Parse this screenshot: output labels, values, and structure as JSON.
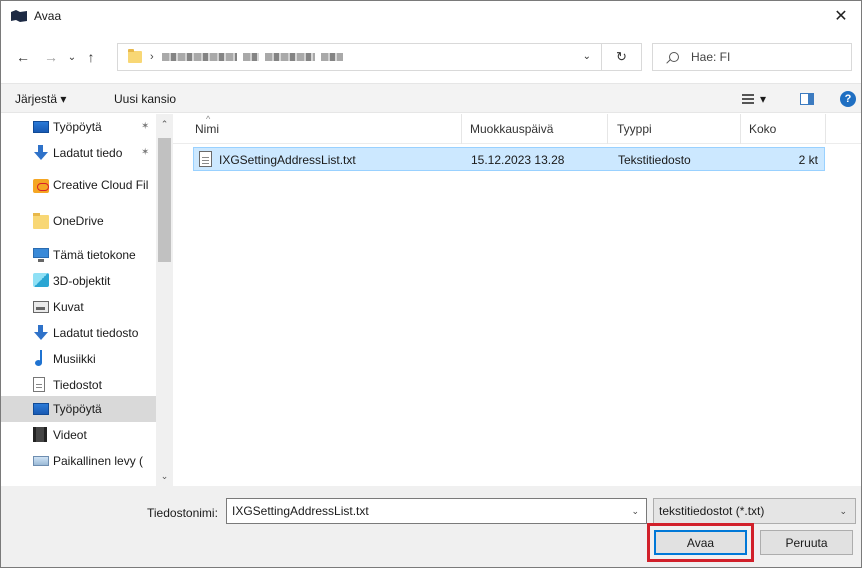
{
  "window": {
    "title": "Avaa",
    "close_glyph": "✕"
  },
  "address": {
    "back_glyph": "←",
    "forward_glyph": "→",
    "recent_glyph": "⌄",
    "up_glyph": "↑",
    "separator_glyph": "›",
    "dropdown_glyph": "⌄",
    "refresh_glyph": "↻",
    "search_placeholder": "Hae: FI"
  },
  "toolbar": {
    "organize_label": "Järjestä ▾",
    "new_folder_label": "Uusi kansio",
    "view_dropdown_glyph": "▾",
    "help_glyph": "?"
  },
  "sidebar": {
    "pin_glyph": "✶",
    "items": [
      {
        "label": "Työpöytä",
        "icon": "desktop-icon",
        "pinned": true
      },
      {
        "label": "Ladatut tiedo",
        "icon": "download-icon",
        "pinned": true
      },
      {
        "label": "Creative Cloud Fil",
        "icon": "creative-cloud-icon"
      },
      {
        "label": "OneDrive",
        "icon": "folder-icon"
      },
      {
        "label": "Tämä tietokone",
        "icon": "computer-icon"
      },
      {
        "label": "3D-objektit",
        "icon": "3d-objects-icon"
      },
      {
        "label": "Kuvat",
        "icon": "pictures-icon"
      },
      {
        "label": "Ladatut tiedosto",
        "icon": "download-icon"
      },
      {
        "label": "Musiikki",
        "icon": "music-icon"
      },
      {
        "label": "Tiedostot",
        "icon": "documents-icon"
      },
      {
        "label": "Työpöytä",
        "icon": "desktop-icon",
        "selected": true
      },
      {
        "label": "Videot",
        "icon": "videos-icon"
      },
      {
        "label": "Paikallinen levy (",
        "icon": "drive-icon"
      }
    ],
    "scroll_up_glyph": "⌃",
    "scroll_down_glyph": "⌄"
  },
  "file_list": {
    "columns": [
      "Nimi",
      "Muokkauspäivä",
      "Tyyppi",
      "Koko"
    ],
    "sort_glyph": "^",
    "rows": [
      {
        "name": "IXGSettingAddressList.txt",
        "modified": "15.12.2023 13.28",
        "type": "Tekstitiedosto",
        "size": "2 kt"
      }
    ]
  },
  "bottom": {
    "filename_label": "Tiedostonimi:",
    "filename_value": "IXGSettingAddressList.txt",
    "filetype_value": "tekstitiedostot (*.txt)",
    "dropdown_glyph": "⌄",
    "open_label": "Avaa",
    "cancel_label": "Peruuta",
    "accent_highlight": "#d1202a"
  }
}
